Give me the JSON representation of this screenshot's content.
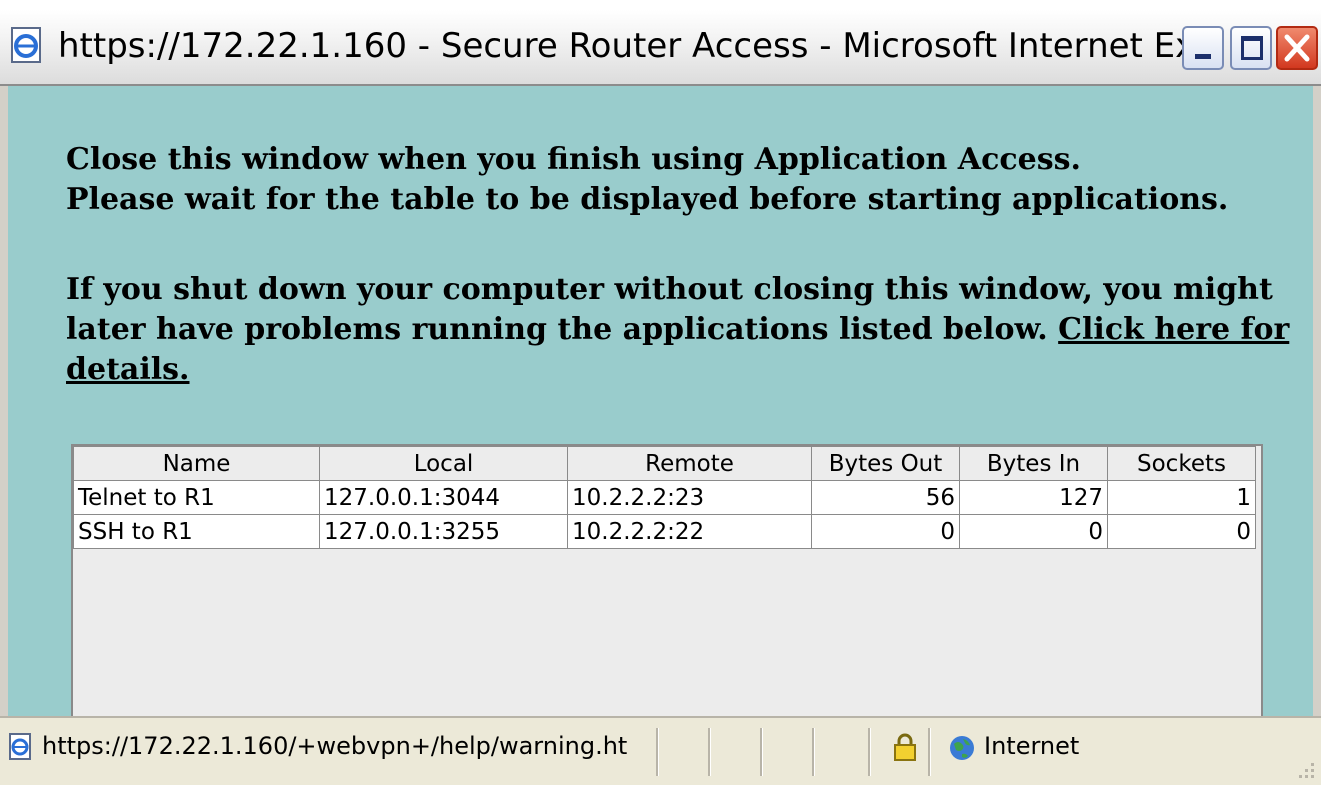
{
  "window": {
    "title": "https://172.22.1.160 - Secure Router Access - Microsoft Internet Ex..."
  },
  "message": {
    "line1": "Close this window when you finish using Application Access.",
    "line2": "Please wait for the table to be displayed before starting applications.",
    "line3": "If you shut down your computer without closing this window, you might",
    "line4_text": "later have problems running the applications listed below. ",
    "link_part1": "Click here for",
    "link_part2": "details."
  },
  "table": {
    "headers": [
      "Name",
      "Local",
      "Remote",
      "Bytes Out",
      "Bytes In",
      "Sockets"
    ],
    "rows": [
      [
        "Telnet to R1",
        "127.0.0.1:3044",
        "10.2.2.2:23",
        "56",
        "127",
        "1"
      ],
      [
        "SSH to R1",
        "127.0.0.1:3255",
        "10.2.2.2:22",
        "0",
        "0",
        "0"
      ]
    ]
  },
  "statusbar": {
    "url": "https://172.22.1.160/+webvpn+/help/warning.ht",
    "zone": "Internet"
  },
  "colors": {
    "content_background": "#99cccc"
  },
  "icons": {
    "app": "ie-page-icon",
    "lock": "lock-icon",
    "zone": "globe-icon"
  }
}
